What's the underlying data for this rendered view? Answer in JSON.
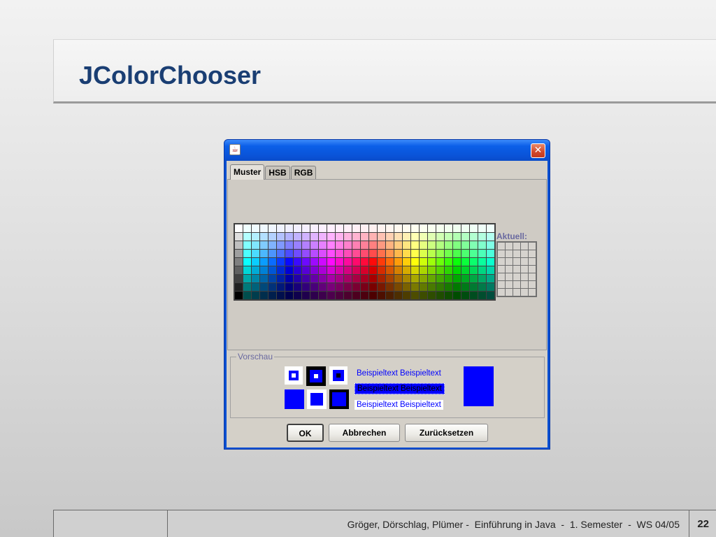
{
  "slide": {
    "title": "JColorChooser",
    "footer_text": "Gröger, Dörschlag, Plümer -  Einführung in Java  -  1. Semester  -  WS 04/05",
    "page_number": "22"
  },
  "dialog": {
    "icon": "java-cup-icon",
    "close_glyph": "✕",
    "tabs": [
      {
        "label": "Muster",
        "active": true
      },
      {
        "label": "HSB",
        "active": false
      },
      {
        "label": "RGB",
        "active": false
      }
    ],
    "recent_label": "Aktuell:",
    "preview_label": "Vorschau",
    "sample_text": "Beispieltext  Beispieltext",
    "preview_color": "#0000ff",
    "buttons": {
      "ok": "OK",
      "cancel": "Abbrechen",
      "reset": "Zurücksetzen"
    }
  }
}
